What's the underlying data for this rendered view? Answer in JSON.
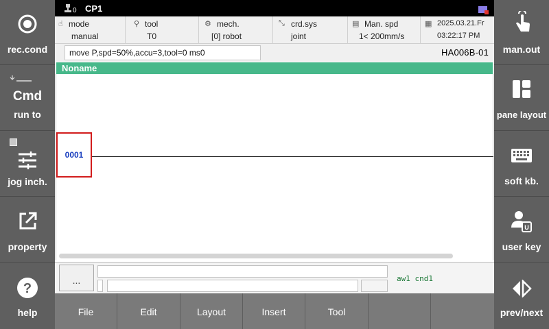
{
  "topbar": {
    "index": "0",
    "name": "CP1"
  },
  "status": {
    "mode": {
      "title": "mode",
      "value": "manual"
    },
    "tool": {
      "title": "tool",
      "value": "T0"
    },
    "mech": {
      "title": "mech.",
      "value": "[0] robot"
    },
    "crd": {
      "title": "crd.sys",
      "value": "joint"
    },
    "spd": {
      "title": "Man. spd",
      "value": "1< 200mm/s"
    },
    "date": {
      "line1": "2025.03.21.Fr",
      "line2": "03:22:17 PM"
    }
  },
  "command": {
    "text": "move P,spd=50%,accu=3,tool=0 ms0"
  },
  "robot_id": "HA006B-01",
  "program": {
    "title": "Noname",
    "step": "0001"
  },
  "input": {
    "more": "...",
    "status": "aw1 cnd1"
  },
  "left_buttons": [
    {
      "label": "rec.cond",
      "icon": "record-icon"
    },
    {
      "label": "Cmd",
      "sublabel": "run to",
      "icon": "step-icon"
    },
    {
      "label": "jog inch.",
      "icon": "sliders-icon"
    },
    {
      "label": "property",
      "icon": "external-link-icon"
    },
    {
      "label": "help",
      "icon": "help-icon"
    }
  ],
  "right_buttons": [
    {
      "label": "man.out",
      "icon": "touch-icon"
    },
    {
      "label": "pane layout",
      "icon": "layout-icon"
    },
    {
      "label": "soft kb.",
      "icon": "keyboard-icon"
    },
    {
      "label": "user key",
      "icon": "user-key-icon"
    },
    {
      "label": "prev/next",
      "icon": "prev-next-icon"
    }
  ],
  "menu": [
    "File",
    "Edit",
    "Layout",
    "Insert",
    "Tool",
    "",
    ""
  ],
  "colors": {
    "side_panel": "#5f5f5f",
    "title_bar": "#47b88a",
    "step_border": "#d21c1c",
    "step_number": "#1a3fbf",
    "menu_bar": "#7a7a7a",
    "status_text": "#1f7a3a"
  }
}
